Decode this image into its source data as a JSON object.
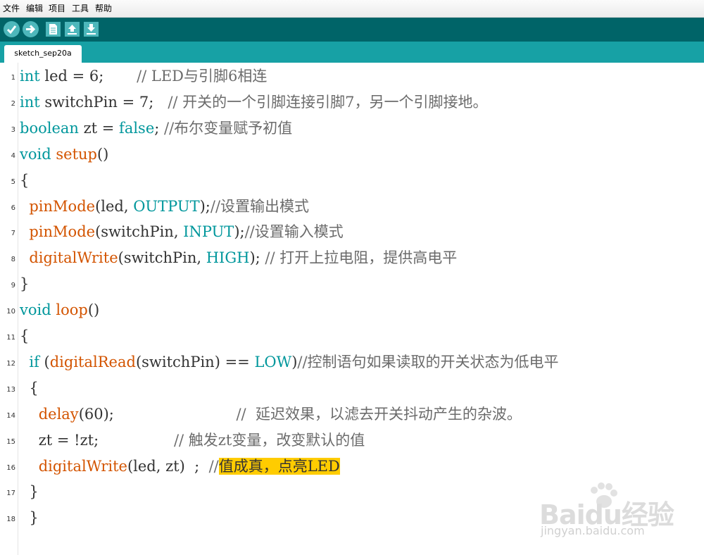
{
  "menu": [
    "文件",
    "编辑",
    "项目",
    "工具",
    "帮助"
  ],
  "toolbar": {
    "buttons": [
      {
        "name": "verify",
        "icon": "check-icon"
      },
      {
        "name": "upload",
        "icon": "arrow-right-icon"
      },
      {
        "name": "new",
        "icon": "new-file-icon"
      },
      {
        "name": "open",
        "icon": "arrow-up-icon"
      },
      {
        "name": "save",
        "icon": "arrow-down-icon"
      }
    ]
  },
  "tab": {
    "label": "sketch_sep20a"
  },
  "colors": {
    "toolbar": "#006468",
    "tabbar": "#17a1a5",
    "keyword": "#00979c",
    "function": "#d35400",
    "highlight": "#ffcc00"
  },
  "code": {
    "line_numbers": [
      "1",
      "2",
      "3",
      "4",
      "5",
      "6",
      "7",
      "8",
      "9",
      "10",
      "11",
      "12",
      "13",
      "14",
      "15",
      "16",
      "17",
      "18"
    ],
    "lines": [
      [
        {
          "t": "int",
          "c": "kw"
        },
        {
          "t": " led = 6;       ",
          "c": ""
        },
        {
          "t": "// LED与引脚6相连",
          "c": "cm"
        }
      ],
      [
        {
          "t": "int",
          "c": "kw"
        },
        {
          "t": " switchPin = 7;   ",
          "c": ""
        },
        {
          "t": "// 开关的一个引脚连接引脚7，另一个引脚接地。",
          "c": "cm"
        }
      ],
      [
        {
          "t": "boolean",
          "c": "kw"
        },
        {
          "t": " zt = ",
          "c": ""
        },
        {
          "t": "false",
          "c": "kw"
        },
        {
          "t": "; ",
          "c": ""
        },
        {
          "t": "//布尔变量赋予初值",
          "c": "cm"
        }
      ],
      [
        {
          "t": "void",
          "c": "kw"
        },
        {
          "t": " ",
          "c": ""
        },
        {
          "t": "setup",
          "c": "fn"
        },
        {
          "t": "()",
          "c": ""
        }
      ],
      [
        {
          "t": "{",
          "c": ""
        }
      ],
      [
        {
          "t": "  ",
          "c": ""
        },
        {
          "t": "pinMode",
          "c": "fn"
        },
        {
          "t": "(led, ",
          "c": ""
        },
        {
          "t": "OUTPUT",
          "c": "kw"
        },
        {
          "t": ");",
          "c": ""
        },
        {
          "t": "//设置输出模式",
          "c": "cm"
        }
      ],
      [
        {
          "t": "  ",
          "c": ""
        },
        {
          "t": "pinMode",
          "c": "fn"
        },
        {
          "t": "(switchPin, ",
          "c": ""
        },
        {
          "t": "INPUT",
          "c": "kw"
        },
        {
          "t": ");",
          "c": ""
        },
        {
          "t": "//设置输入模式",
          "c": "cm"
        }
      ],
      [
        {
          "t": "  ",
          "c": ""
        },
        {
          "t": "digitalWrite",
          "c": "fn"
        },
        {
          "t": "(switchPin, ",
          "c": ""
        },
        {
          "t": "HIGH",
          "c": "kw"
        },
        {
          "t": "); ",
          "c": ""
        },
        {
          "t": "// 打开上拉电阻，提供高电平",
          "c": "cm"
        }
      ],
      [
        {
          "t": "}",
          "c": ""
        }
      ],
      [
        {
          "t": "void",
          "c": "kw"
        },
        {
          "t": " ",
          "c": ""
        },
        {
          "t": "loop",
          "c": "fn"
        },
        {
          "t": "()",
          "c": ""
        }
      ],
      [
        {
          "t": "{",
          "c": ""
        }
      ],
      [
        {
          "t": "  ",
          "c": ""
        },
        {
          "t": "if",
          "c": "kw"
        },
        {
          "t": " (",
          "c": ""
        },
        {
          "t": "digitalRead",
          "c": "fn"
        },
        {
          "t": "(switchPin) == ",
          "c": ""
        },
        {
          "t": "LOW",
          "c": "kw"
        },
        {
          "t": ")",
          "c": ""
        },
        {
          "t": "//控制语句如果读取的开关状态为低电平",
          "c": "cm"
        }
      ],
      [
        {
          "t": "  {",
          "c": ""
        }
      ],
      [
        {
          "t": "    ",
          "c": ""
        },
        {
          "t": "delay",
          "c": "fn"
        },
        {
          "t": "(60);                          ",
          "c": ""
        },
        {
          "t": "//  延迟效果，以滤去开关抖动产生的杂波。",
          "c": "cm"
        }
      ],
      [
        {
          "t": "    zt = !zt;                ",
          "c": ""
        },
        {
          "t": "// 触发zt变量，改变默认的值",
          "c": "cm"
        }
      ],
      [
        {
          "t": "    ",
          "c": ""
        },
        {
          "t": "digitalWrite",
          "c": "fn"
        },
        {
          "t": "(led, zt)  ;  ",
          "c": ""
        },
        {
          "t": "//",
          "c": "cm"
        },
        {
          "t": "值成真，点亮LED",
          "c": "hl"
        }
      ],
      [
        {
          "t": "  }",
          "c": ""
        }
      ],
      [
        {
          "t": "  }",
          "c": ""
        }
      ]
    ]
  },
  "watermark": {
    "brand": "Baidu经验",
    "url": "jingyan.baidu.com"
  }
}
